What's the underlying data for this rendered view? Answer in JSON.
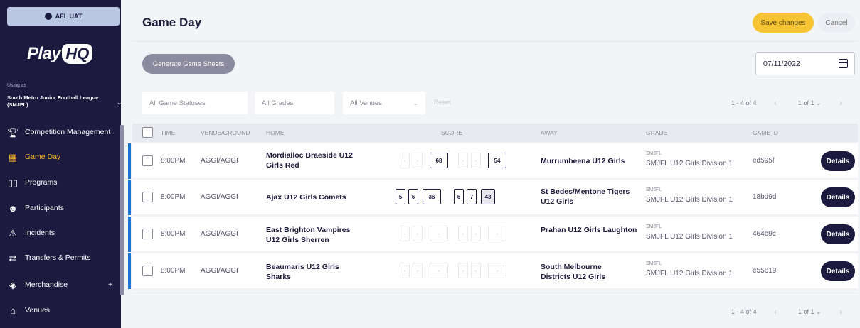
{
  "env_badge": "AFL UAT",
  "brand": {
    "play": "Play",
    "hq": "HQ"
  },
  "using_as": "Using as",
  "org_name": "South Metro Junior Football League (SMJFL)",
  "nav": [
    {
      "label": "Competition Management",
      "icon": "trophy-icon"
    },
    {
      "label": "Game Day",
      "icon": "scoreboard-icon",
      "active": true
    },
    {
      "label": "Programs",
      "icon": "book-icon"
    },
    {
      "label": "Participants",
      "icon": "people-icon"
    },
    {
      "label": "Incidents",
      "icon": "warning-icon"
    },
    {
      "label": "Transfers & Permits",
      "icon": "transfer-arrows-icon"
    },
    {
      "label": "Merchandise",
      "icon": "box-icon",
      "plus": "+"
    },
    {
      "label": "Venues",
      "icon": "stadium-icon"
    }
  ],
  "page_title": "Game Day",
  "save_label": "Save changes",
  "cancel_label": "Cancel",
  "generate_label": "Generate Game Sheets",
  "date_value": "07/11/2022",
  "filters": {
    "statuses": "All Game Statuses",
    "grades": "All Grades",
    "venues": "All Venues",
    "reset": "Reset"
  },
  "pager_top": {
    "count": "1 - 4 of 4",
    "page": "1 of 1"
  },
  "pager_bottom": {
    "count": "1 - 4 of 4",
    "page": "1 of 1"
  },
  "columns": [
    "TIME",
    "VENUE/GROUND",
    "HOME",
    "SCORE",
    "AWAY",
    "GRADE",
    "GAME ID"
  ],
  "rows": [
    {
      "time": "8:00PM",
      "venue": "AGGI/AGGI",
      "home": "Mordialloc Braeside U12 Girls Red",
      "home_scores": [
        "-",
        "-",
        "68"
      ],
      "away_scores": [
        "-",
        "-",
        "54"
      ],
      "away": "Murrumbeena U12 Girls",
      "grade_small": "SMJFL",
      "grade": "SMJFL U12 Girls Division 1",
      "game_id": "ed595f",
      "details": "Details"
    },
    {
      "time": "8:00PM",
      "venue": "AGGI/AGGI",
      "home": "Ajax U12 Girls Comets",
      "home_scores": [
        "5",
        "6",
        "36"
      ],
      "away_scores": [
        "6",
        "7",
        "43"
      ],
      "away": "St Bedes/Mentone Tigers U12 Girls",
      "grade_small": "SMJFL",
      "grade": "SMJFL U12 Girls Division 1",
      "game_id": "18bd9d",
      "details": "Details"
    },
    {
      "time": "8:00PM",
      "venue": "AGGI/AGGI",
      "home": "East Brighton Vampires U12 Girls Sherren",
      "home_scores": [
        "-",
        "-",
        "-"
      ],
      "away_scores": [
        "-",
        "-",
        "-"
      ],
      "away": "Prahan U12 Girls Laughton",
      "grade_small": "SMJFL",
      "grade": "SMJFL U12 Girls Division 1",
      "game_id": "464b9c",
      "details": "Details"
    },
    {
      "time": "8:00PM",
      "venue": "AGGI/AGGI",
      "home": "Beaumaris U12 Girls Sharks",
      "home_scores": [
        "-",
        "-",
        "-"
      ],
      "away_scores": [
        "-",
        "-",
        "-"
      ],
      "away": "South Melbourne Districts U12 Girls",
      "grade_small": "SMJFL",
      "grade": "SMJFL U12 Girls Division 1",
      "game_id": "e55619",
      "details": "Details"
    }
  ]
}
